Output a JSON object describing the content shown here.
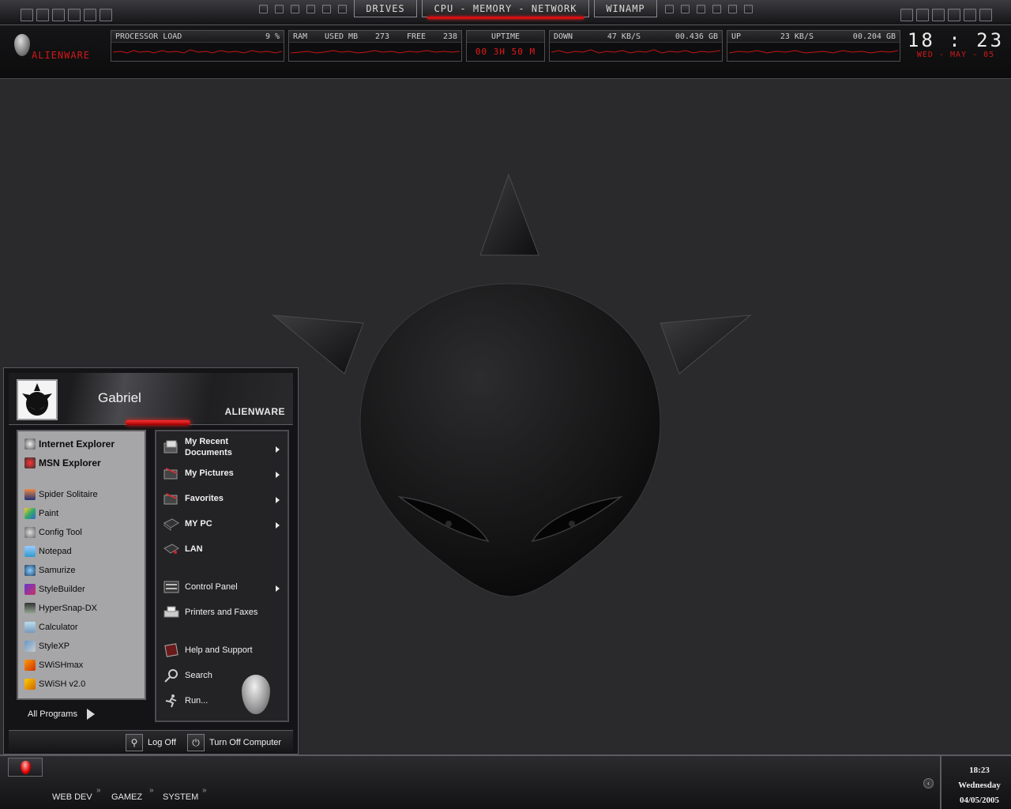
{
  "colors": {
    "desktop_bg": "#2a2a2d",
    "accent_red": "#d80e0e",
    "menu_left_bg": "#a6a6a8"
  },
  "topbar": {
    "tabs": [
      {
        "label": "DRIVES"
      },
      {
        "label": "CPU - MEMORY - NETWORK",
        "active": true
      },
      {
        "label": "WINAMP"
      }
    ],
    "logo_text": "ALIENWARE",
    "cpu": {
      "label": "PROCESSOR LOAD",
      "value": "9 %"
    },
    "ram": {
      "label": "RAM",
      "used_label": "USED MB",
      "used_value": "273",
      "free_label": "FREE",
      "free_value": "238"
    },
    "uptime": {
      "label": "UPTIME",
      "value": "00 3H 50 M"
    },
    "down": {
      "label": "DOWN",
      "rate": "47 KB/S",
      "total": "00.436 GB"
    },
    "up": {
      "label": "UP",
      "rate": "23 KB/S",
      "total": "00.204 GB"
    },
    "clock": {
      "time": "18 : 23",
      "date": "WED - MAY - 05"
    }
  },
  "start_menu": {
    "user_name": "Gabriel",
    "brand": "ALIENWARE",
    "pinned": [
      {
        "label": "Internet Explorer",
        "icon": "internet-explorer-icon"
      },
      {
        "label": "MSN Explorer",
        "icon": "msn-explorer-icon"
      }
    ],
    "recent": [
      {
        "label": "Spider Solitaire",
        "icon": "spider-solitaire-icon"
      },
      {
        "label": "Paint",
        "icon": "paint-icon"
      },
      {
        "label": "Config Tool",
        "icon": "config-tool-icon"
      },
      {
        "label": "Notepad",
        "icon": "notepad-icon"
      },
      {
        "label": "Samurize",
        "icon": "samurize-icon"
      },
      {
        "label": "StyleBuilder",
        "icon": "stylebuilder-icon"
      },
      {
        "label": "HyperSnap-DX",
        "icon": "hypersnap-icon"
      },
      {
        "label": "Calculator",
        "icon": "calculator-icon"
      },
      {
        "label": "StyleXP",
        "icon": "stylexp-icon"
      },
      {
        "label": "SWiSHmax",
        "icon": "swishmax-icon"
      },
      {
        "label": "SWiSH v2.0",
        "icon": "swish-icon"
      }
    ],
    "all_programs": "All Programs",
    "places": [
      {
        "line1": "My Recent",
        "line2": "Documents",
        "icon": "recent-documents-icon"
      },
      {
        "label": "My Pictures",
        "icon": "my-pictures-icon"
      },
      {
        "label": "Favorites",
        "icon": "favorites-icon"
      },
      {
        "label": "MY PC",
        "icon": "my-pc-icon"
      },
      {
        "label": "LAN",
        "icon": "lan-icon"
      },
      {
        "label": "Control Panel",
        "icon": "control-panel-icon"
      },
      {
        "label": "Printers and Faxes",
        "icon": "printers-icon"
      },
      {
        "label": "Help and Support",
        "icon": "help-icon"
      },
      {
        "label": "Search",
        "icon": "search-icon"
      },
      {
        "label": "Run...",
        "icon": "run-icon"
      }
    ],
    "log_off": "Log Off",
    "turn_off": "Turn Off Computer"
  },
  "taskbar": {
    "toolbar_links": [
      "WEB DEV",
      "GAMEZ",
      "SYSTEM"
    ],
    "tray": {
      "time": "18:23",
      "day": "Wednesday",
      "date": "04/05/2005"
    }
  }
}
